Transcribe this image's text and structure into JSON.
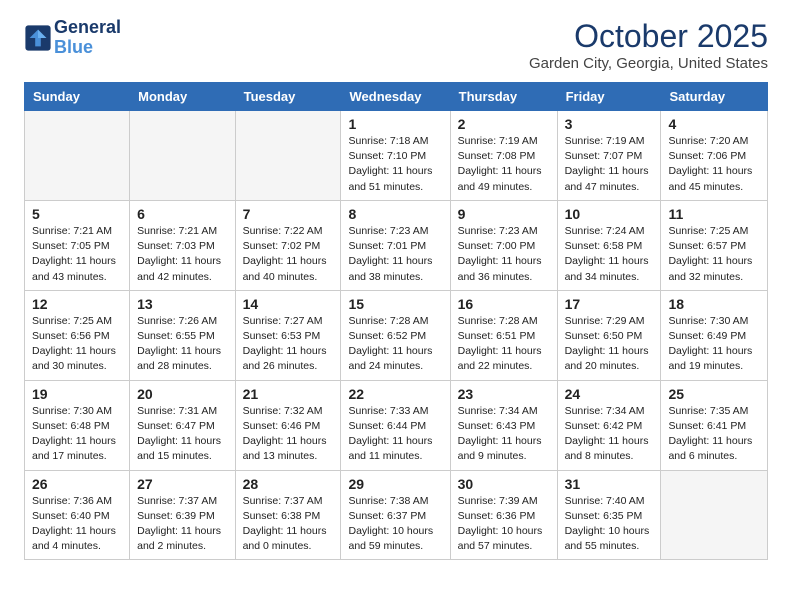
{
  "header": {
    "logo_line1": "General",
    "logo_line2": "Blue",
    "month": "October 2025",
    "location": "Garden City, Georgia, United States"
  },
  "weekdays": [
    "Sunday",
    "Monday",
    "Tuesday",
    "Wednesday",
    "Thursday",
    "Friday",
    "Saturday"
  ],
  "weeks": [
    [
      {
        "day": "",
        "content": ""
      },
      {
        "day": "",
        "content": ""
      },
      {
        "day": "",
        "content": ""
      },
      {
        "day": "1",
        "content": "Sunrise: 7:18 AM\nSunset: 7:10 PM\nDaylight: 11 hours\nand 51 minutes."
      },
      {
        "day": "2",
        "content": "Sunrise: 7:19 AM\nSunset: 7:08 PM\nDaylight: 11 hours\nand 49 minutes."
      },
      {
        "day": "3",
        "content": "Sunrise: 7:19 AM\nSunset: 7:07 PM\nDaylight: 11 hours\nand 47 minutes."
      },
      {
        "day": "4",
        "content": "Sunrise: 7:20 AM\nSunset: 7:06 PM\nDaylight: 11 hours\nand 45 minutes."
      }
    ],
    [
      {
        "day": "5",
        "content": "Sunrise: 7:21 AM\nSunset: 7:05 PM\nDaylight: 11 hours\nand 43 minutes."
      },
      {
        "day": "6",
        "content": "Sunrise: 7:21 AM\nSunset: 7:03 PM\nDaylight: 11 hours\nand 42 minutes."
      },
      {
        "day": "7",
        "content": "Sunrise: 7:22 AM\nSunset: 7:02 PM\nDaylight: 11 hours\nand 40 minutes."
      },
      {
        "day": "8",
        "content": "Sunrise: 7:23 AM\nSunset: 7:01 PM\nDaylight: 11 hours\nand 38 minutes."
      },
      {
        "day": "9",
        "content": "Sunrise: 7:23 AM\nSunset: 7:00 PM\nDaylight: 11 hours\nand 36 minutes."
      },
      {
        "day": "10",
        "content": "Sunrise: 7:24 AM\nSunset: 6:58 PM\nDaylight: 11 hours\nand 34 minutes."
      },
      {
        "day": "11",
        "content": "Sunrise: 7:25 AM\nSunset: 6:57 PM\nDaylight: 11 hours\nand 32 minutes."
      }
    ],
    [
      {
        "day": "12",
        "content": "Sunrise: 7:25 AM\nSunset: 6:56 PM\nDaylight: 11 hours\nand 30 minutes."
      },
      {
        "day": "13",
        "content": "Sunrise: 7:26 AM\nSunset: 6:55 PM\nDaylight: 11 hours\nand 28 minutes."
      },
      {
        "day": "14",
        "content": "Sunrise: 7:27 AM\nSunset: 6:53 PM\nDaylight: 11 hours\nand 26 minutes."
      },
      {
        "day": "15",
        "content": "Sunrise: 7:28 AM\nSunset: 6:52 PM\nDaylight: 11 hours\nand 24 minutes."
      },
      {
        "day": "16",
        "content": "Sunrise: 7:28 AM\nSunset: 6:51 PM\nDaylight: 11 hours\nand 22 minutes."
      },
      {
        "day": "17",
        "content": "Sunrise: 7:29 AM\nSunset: 6:50 PM\nDaylight: 11 hours\nand 20 minutes."
      },
      {
        "day": "18",
        "content": "Sunrise: 7:30 AM\nSunset: 6:49 PM\nDaylight: 11 hours\nand 19 minutes."
      }
    ],
    [
      {
        "day": "19",
        "content": "Sunrise: 7:30 AM\nSunset: 6:48 PM\nDaylight: 11 hours\nand 17 minutes."
      },
      {
        "day": "20",
        "content": "Sunrise: 7:31 AM\nSunset: 6:47 PM\nDaylight: 11 hours\nand 15 minutes."
      },
      {
        "day": "21",
        "content": "Sunrise: 7:32 AM\nSunset: 6:46 PM\nDaylight: 11 hours\nand 13 minutes."
      },
      {
        "day": "22",
        "content": "Sunrise: 7:33 AM\nSunset: 6:44 PM\nDaylight: 11 hours\nand 11 minutes."
      },
      {
        "day": "23",
        "content": "Sunrise: 7:34 AM\nSunset: 6:43 PM\nDaylight: 11 hours\nand 9 minutes."
      },
      {
        "day": "24",
        "content": "Sunrise: 7:34 AM\nSunset: 6:42 PM\nDaylight: 11 hours\nand 8 minutes."
      },
      {
        "day": "25",
        "content": "Sunrise: 7:35 AM\nSunset: 6:41 PM\nDaylight: 11 hours\nand 6 minutes."
      }
    ],
    [
      {
        "day": "26",
        "content": "Sunrise: 7:36 AM\nSunset: 6:40 PM\nDaylight: 11 hours\nand 4 minutes."
      },
      {
        "day": "27",
        "content": "Sunrise: 7:37 AM\nSunset: 6:39 PM\nDaylight: 11 hours\nand 2 minutes."
      },
      {
        "day": "28",
        "content": "Sunrise: 7:37 AM\nSunset: 6:38 PM\nDaylight: 11 hours\nand 0 minutes."
      },
      {
        "day": "29",
        "content": "Sunrise: 7:38 AM\nSunset: 6:37 PM\nDaylight: 10 hours\nand 59 minutes."
      },
      {
        "day": "30",
        "content": "Sunrise: 7:39 AM\nSunset: 6:36 PM\nDaylight: 10 hours\nand 57 minutes."
      },
      {
        "day": "31",
        "content": "Sunrise: 7:40 AM\nSunset: 6:35 PM\nDaylight: 10 hours\nand 55 minutes."
      },
      {
        "day": "",
        "content": ""
      }
    ]
  ]
}
